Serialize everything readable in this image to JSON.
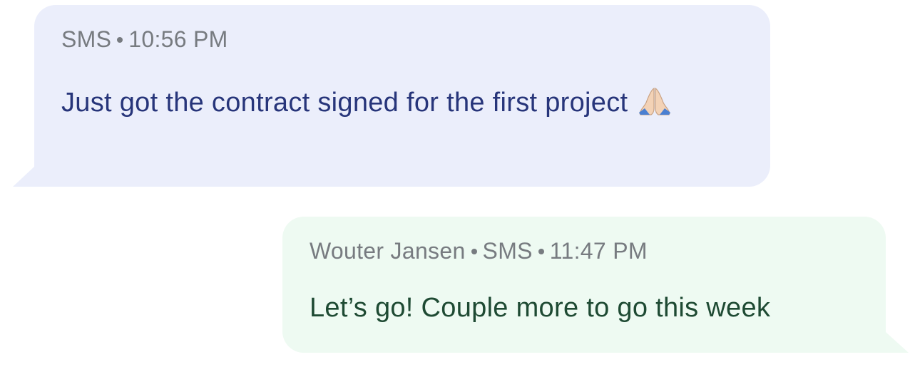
{
  "messages": [
    {
      "direction": "incoming",
      "channel": "SMS",
      "time": "10:56 PM",
      "text": "Just got the contract signed for the first project",
      "emoji": "folded-hands-icon"
    },
    {
      "direction": "outgoing",
      "sender": "Wouter Jansen",
      "channel": "SMS",
      "time": "11:47 PM",
      "text": "Let’s go! Couple more to go this week"
    }
  ],
  "colors": {
    "incoming_bubble": "#ebeefb",
    "incoming_text": "#27357a",
    "outgoing_bubble": "#eefaf2",
    "outgoing_text": "#1e4a33",
    "meta_text": "#777b80"
  }
}
